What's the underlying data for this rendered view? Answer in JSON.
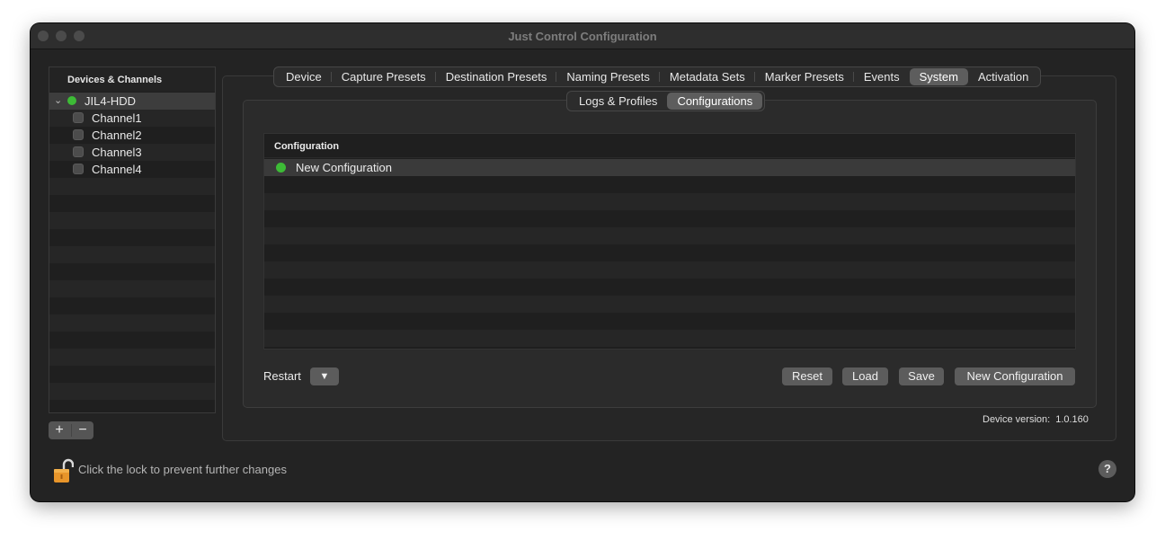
{
  "window": {
    "title": "Just Control Configuration"
  },
  "sidebar": {
    "header": "Devices & Channels",
    "device": {
      "label": "JIL4-HDD",
      "status_color": "#3dbb36"
    },
    "channels": [
      "Channel1",
      "Channel2",
      "Channel3",
      "Channel4"
    ],
    "add_label": "+",
    "remove_label": "−"
  },
  "tabs": [
    "Device",
    "Capture Presets",
    "Destination Presets",
    "Naming Presets",
    "Metadata Sets",
    "Marker Presets",
    "Events",
    "System",
    "Activation"
  ],
  "active_tab": "System",
  "subtabs": [
    "Logs & Profiles",
    "Configurations"
  ],
  "active_subtab": "Configurations",
  "table": {
    "header": "Configuration",
    "rows": [
      {
        "label": "New Configuration",
        "status_color": "#3dbb36"
      }
    ]
  },
  "controls": {
    "restart_label": "Restart",
    "dropdown_icon": "▼",
    "reset_label": "Reset",
    "load_label": "Load",
    "save_label": "Save",
    "new_config_label": "New Configuration"
  },
  "status": {
    "version_label": "Device version:",
    "version_value": "1.0.160"
  },
  "footer": {
    "lock_text": "Click the lock to prevent further changes",
    "help_label": "?"
  },
  "colors": {
    "accent_green": "#3dbb36",
    "lock_orange": "#e8952a"
  }
}
